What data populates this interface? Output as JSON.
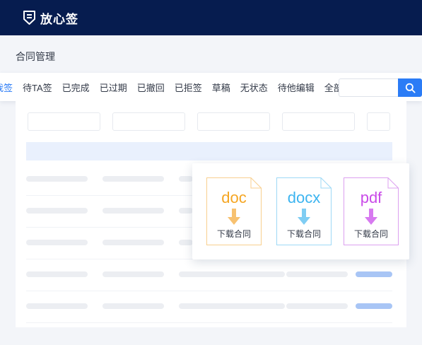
{
  "app": {
    "brand": "放心签",
    "logo_icon": "shield-document-icon"
  },
  "page": {
    "title": "合同管理"
  },
  "tabs": [
    {
      "label": "我签",
      "active": true
    },
    {
      "label": "待TA签",
      "active": false
    },
    {
      "label": "已完成",
      "active": false
    },
    {
      "label": "已过期",
      "active": false
    },
    {
      "label": "已撤回",
      "active": false
    },
    {
      "label": "已拒签",
      "active": false
    },
    {
      "label": "草稿",
      "active": false
    },
    {
      "label": "无状态",
      "active": false
    },
    {
      "label": "待他编辑",
      "active": false
    },
    {
      "label": "全部",
      "active": false
    }
  ],
  "search": {
    "value": "",
    "placeholder": "",
    "icon": "search-icon"
  },
  "download_popup": {
    "files": [
      {
        "ext": "doc",
        "label": "下载合同",
        "color": "#f5a623",
        "arrow_color": "#f7c170",
        "border_color": "#f8cf8f"
      },
      {
        "ext": "docx",
        "label": "下载合同",
        "color": "#3cb4f0",
        "arrow_color": "#7fcdf3",
        "border_color": "#9ed9f6"
      },
      {
        "ext": "pdf",
        "label": "下载合同",
        "color": "#c94be8",
        "arrow_color": "#d77af0",
        "border_color": "#dca0f0"
      }
    ]
  },
  "colors": {
    "topbar": "#061c4f",
    "accent": "#2b7cf6",
    "table_header": "#e9f0fd",
    "placeholder_bar": "#eceef2",
    "status_bar": "#a8c5f5"
  }
}
